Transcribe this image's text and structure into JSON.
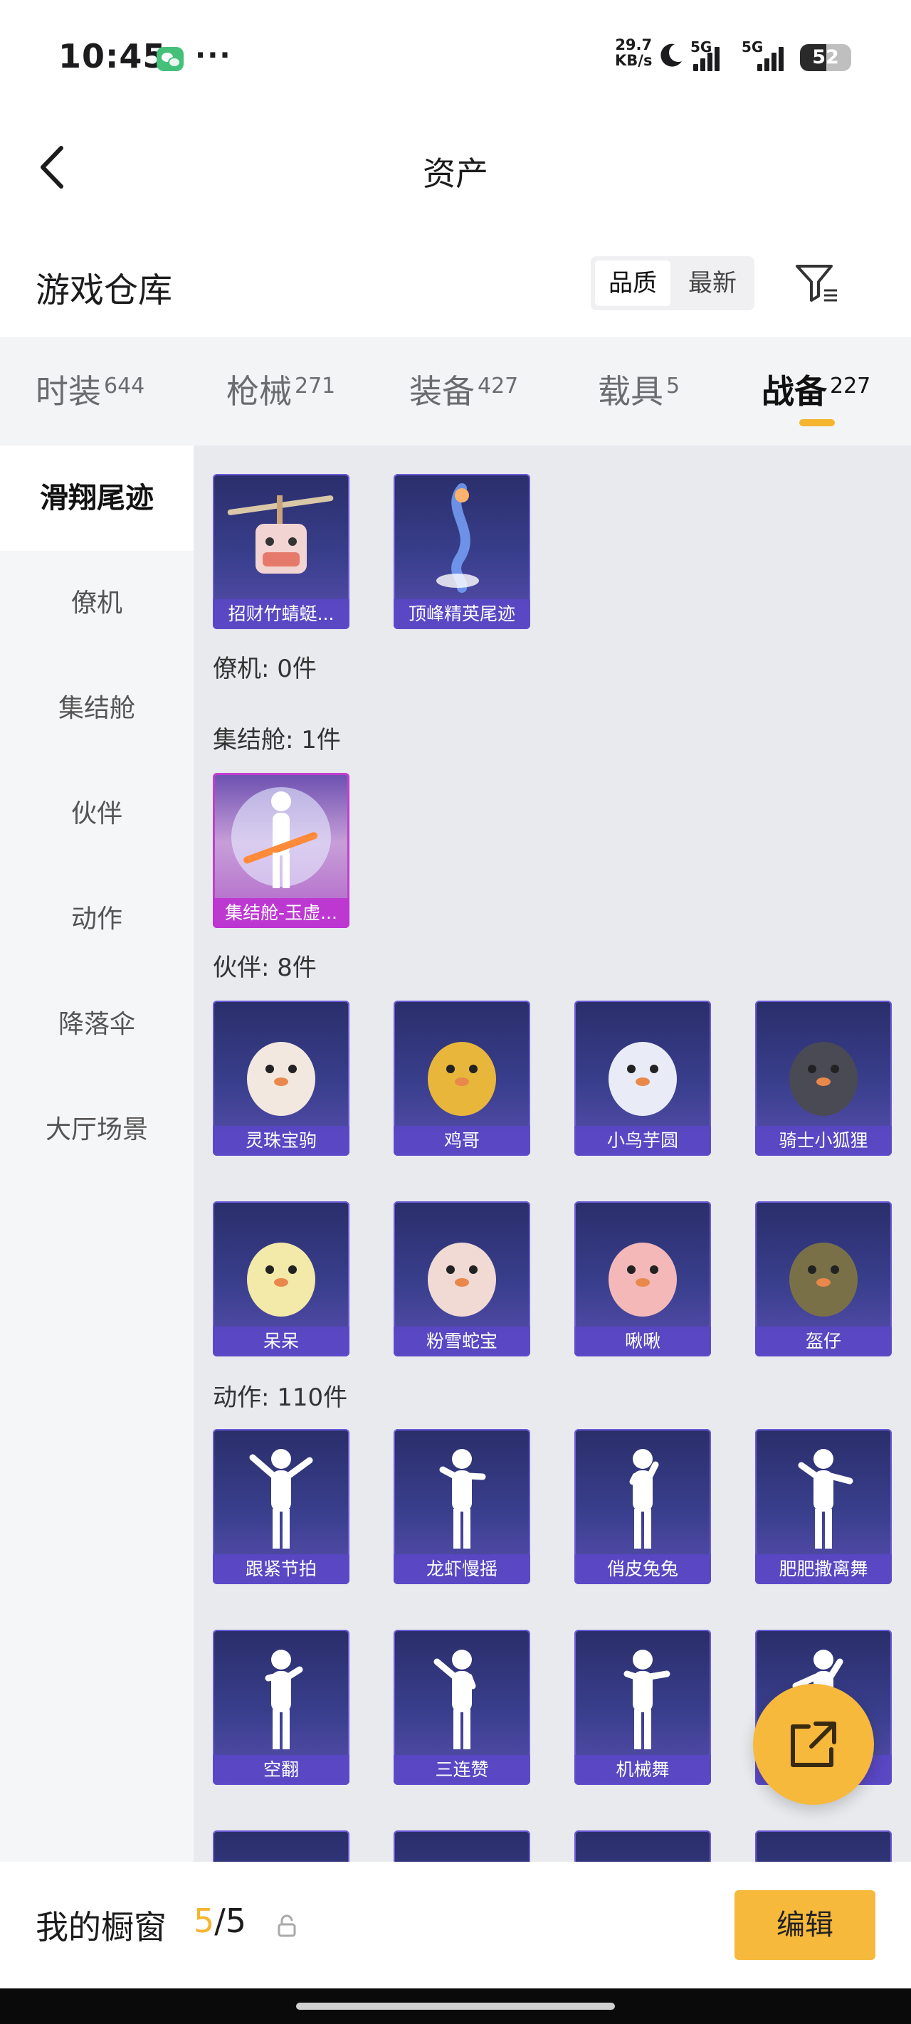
{
  "status_bar": {
    "time": "10:45",
    "net_speed_value": "29.7",
    "net_speed_unit": "KB/s",
    "net1": "5G",
    "net2": "5G",
    "battery": "52",
    "battery_level": 0.52
  },
  "nav": {
    "title": "资产"
  },
  "warehouse": {
    "title": "游戏仓库",
    "sort_options": [
      "品质",
      "最新"
    ],
    "sort_selected": "品质"
  },
  "category_tabs": [
    {
      "label": "时装",
      "count": "644"
    },
    {
      "label": "枪械",
      "count": "271"
    },
    {
      "label": "装备",
      "count": "427"
    },
    {
      "label": "载具",
      "count": "5"
    },
    {
      "label": "战备",
      "count": "227",
      "active": true
    }
  ],
  "sidebar": {
    "items": [
      {
        "label": "滑翔尾迹",
        "active": true
      },
      {
        "label": "僚机"
      },
      {
        "label": "集结舱"
      },
      {
        "label": "伙伴"
      },
      {
        "label": "动作"
      },
      {
        "label": "降落伞"
      },
      {
        "label": "大厅场景"
      }
    ]
  },
  "content": {
    "glide_items": [
      "招财竹蜻蜓...",
      "顶峰精英尾迹"
    ],
    "wingman_label": "僚机: 0件",
    "assembly_label": "集结舱: 1件",
    "assembly_items": [
      "集结舱-玉虚..."
    ],
    "partner_label": "伙伴: 8件",
    "partner_items": [
      "灵珠宝驹",
      "鸡哥",
      "小鸟芋圆",
      "骑士小狐狸",
      "呆呆",
      "粉雪蛇宝",
      "啾啾",
      "盔仔"
    ],
    "action_label": "动作: 110件",
    "action_items": [
      "跟紧节拍",
      "龙虾慢摇",
      "俏皮兔兔",
      "肥肥撒离舞",
      "空翻",
      "三连赞",
      "机械舞",
      ""
    ]
  },
  "bottom": {
    "title": "我的橱窗",
    "count_current": "5",
    "count_sep": "/",
    "count_total": "5",
    "edit_label": "编辑"
  },
  "icons": {
    "back": "chevron-left-icon",
    "filter": "filter-icon",
    "share": "share-external-icon",
    "lock": "lock-icon"
  },
  "colors": {
    "accent": "#f5b52e",
    "card_bg": "#3a3f8e",
    "card_label": "#5a46c8",
    "rare_card": "#c23fd0"
  }
}
